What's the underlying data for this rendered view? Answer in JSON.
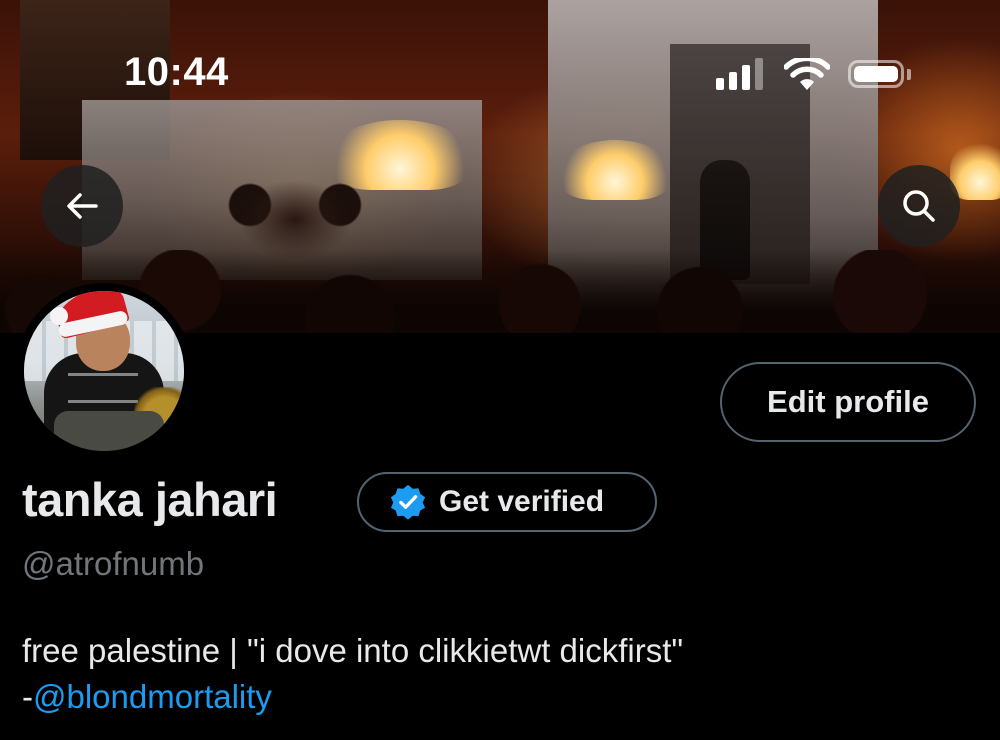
{
  "status_bar": {
    "time": "10:44"
  },
  "profile": {
    "display_name": "tanka jahari",
    "handle": "@atrofnumb",
    "bio_text": "free palestine | \"i dove into clikkietwt dickfirst\"",
    "bio_prefix": "-",
    "bio_mention": "@blondmortality"
  },
  "buttons": {
    "edit_profile": "Edit profile",
    "get_verified": "Get verified"
  },
  "icons": {
    "back": "arrow-left-icon",
    "search": "search-icon",
    "verified": "verified-badge-icon"
  },
  "colors": {
    "background": "#000000",
    "text_primary": "#e7e9ea",
    "text_secondary": "#71767b",
    "accent_blue": "#1d9bf0",
    "button_border": "#536471"
  }
}
